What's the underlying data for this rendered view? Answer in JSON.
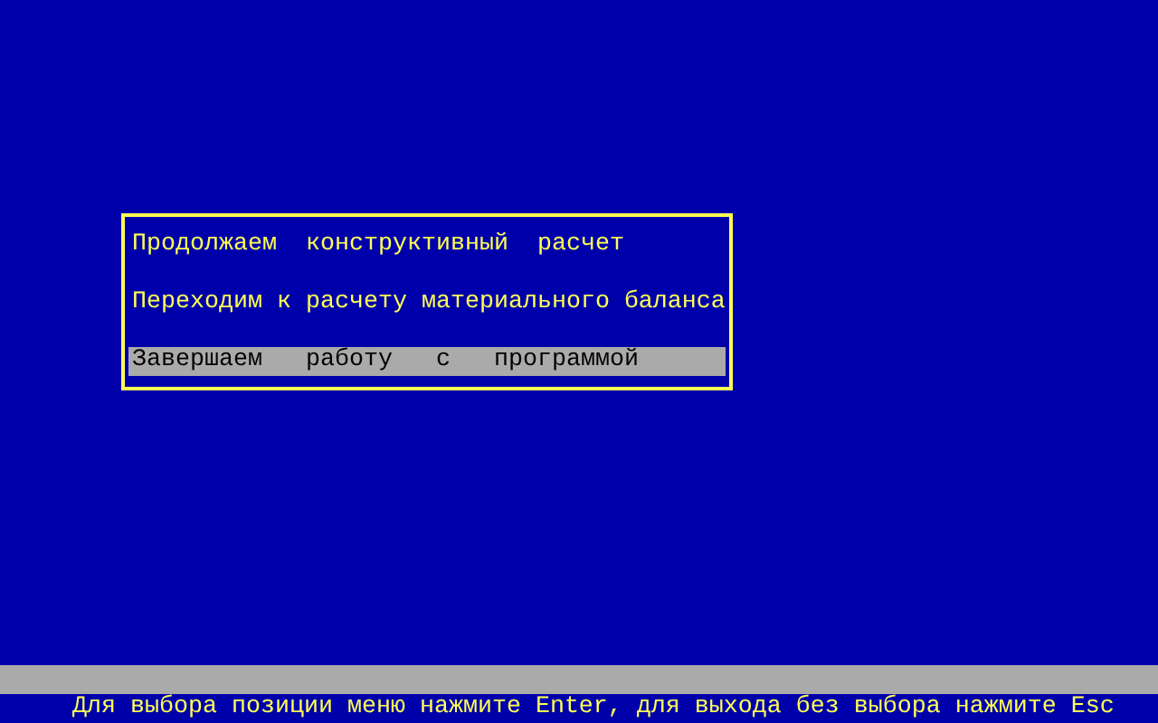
{
  "menu": {
    "items": [
      {
        "label": "Продолжаем  конструктивный  расчет",
        "selected": false
      },
      {
        "label": "Переходим к расчету материального баланса",
        "selected": false
      },
      {
        "label": "Завершаем   работу   с   программой",
        "selected": true
      }
    ]
  },
  "status_bar": {
    "hint": "Для выбора позиции меню нажмите Enter, для выхода без выбора нажмите Esc"
  }
}
